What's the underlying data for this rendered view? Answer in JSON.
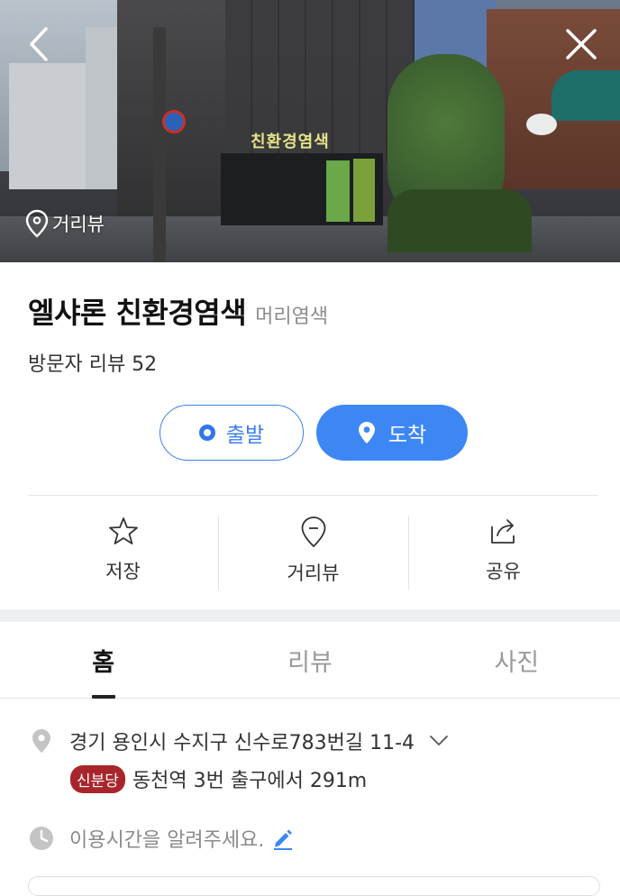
{
  "hero": {
    "roadview_label": "거리뷰",
    "store_sign": "친환경염색"
  },
  "place": {
    "name": "엘샤론 친환경염색",
    "category": "머리염색",
    "reviews": "방문자 리뷰 52"
  },
  "route": {
    "start_label": "출발",
    "dest_label": "도착",
    "accent_color": "#3d87f5"
  },
  "actions": [
    {
      "label": "저장",
      "icon": "star-icon"
    },
    {
      "label": "거리뷰",
      "icon": "pin-icon"
    },
    {
      "label": "공유",
      "icon": "share-icon"
    }
  ],
  "tabs": [
    {
      "label": "홈",
      "active": true
    },
    {
      "label": "리뷰",
      "active": false
    },
    {
      "label": "사진",
      "active": false
    }
  ],
  "info": {
    "address": "경기 용인시 수지구 신수로783번길 11-4",
    "line_badge": "신분당",
    "line_color": "#a8262b",
    "station": "동천역 3번 출구에서 291m",
    "hours_prompt": "이용시간을 알려주세요."
  }
}
